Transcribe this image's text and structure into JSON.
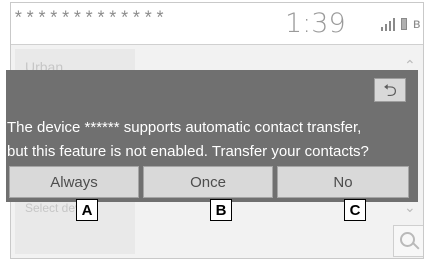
{
  "status_bar": {
    "device_name": "*************",
    "clock": "1:39",
    "icons": [
      "signal-icon",
      "battery-icon",
      "bluetooth-icon"
    ]
  },
  "background": {
    "list_item_top": "Urban",
    "list_item_bottom": "Select device"
  },
  "dialog": {
    "message_line1": "The device ****** supports automatic contact transfer,",
    "message_line2": "but this feature is not enabled. Transfer your contacts?",
    "back_icon": "back-icon",
    "buttons": {
      "always": "Always",
      "once": "Once",
      "no": "No"
    }
  },
  "callouts": {
    "a": "A",
    "b": "B",
    "c": "C"
  },
  "colors": {
    "dialog_background": "#707070",
    "button_background": "#d9d9d9",
    "message_text": "#ffffff"
  }
}
